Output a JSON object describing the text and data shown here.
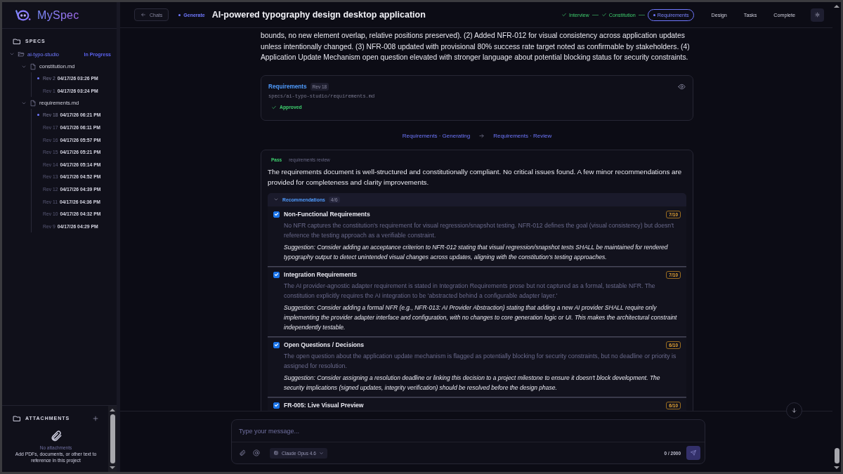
{
  "app_name": "MySpec",
  "sidebar": {
    "specs_heading": "SPECS",
    "specs": [
      {
        "name": "ai-typo-studio",
        "status": "In Progress",
        "expanded": true,
        "children": [
          {
            "name": "constitution.md",
            "expanded": true,
            "children": [
              {
                "rev": "Rev 2",
                "date": "04/17/26 03:26 PM",
                "selected": true
              },
              {
                "rev": "Rev 1",
                "date": "04/17/26 03:24 PM",
                "selected": false
              }
            ]
          },
          {
            "name": "requirements.md",
            "expanded": true,
            "children": [
              {
                "rev": "Rev 18",
                "date": "04/17/26 06:21 PM",
                "selected": true
              },
              {
                "rev": "Rev 17",
                "date": "04/17/26 06:11 PM",
                "selected": false
              },
              {
                "rev": "Rev 16",
                "date": "04/17/26 05:57 PM",
                "selected": false
              },
              {
                "rev": "Rev 15",
                "date": "04/17/26 05:21 PM",
                "selected": false
              },
              {
                "rev": "Rev 14",
                "date": "04/17/26 05:14 PM",
                "selected": false
              },
              {
                "rev": "Rev 13",
                "date": "04/17/26 04:52 PM",
                "selected": false
              },
              {
                "rev": "Rev 12",
                "date": "04/17/26 04:39 PM",
                "selected": false
              },
              {
                "rev": "Rev 11",
                "date": "04/17/26 04:36 PM",
                "selected": false
              },
              {
                "rev": "Rev 10",
                "date": "04/17/26 04:32 PM",
                "selected": false
              },
              {
                "rev": "Rev 9",
                "date": "04/17/26 04:29 PM",
                "selected": false
              }
            ]
          }
        ]
      }
    ],
    "attachments": {
      "heading": "ATTACHMENTS",
      "empty_title": "No attachments",
      "empty_hint": "Add PDFs, documents, or other text to reference in this project"
    }
  },
  "header": {
    "back_label": "Chats",
    "mode": "Generate",
    "title": "AI-powered typography design desktop application",
    "steps": [
      {
        "label": "Interview",
        "done": true,
        "selected": false
      },
      {
        "label": "Constitution",
        "done": true,
        "selected": false
      },
      {
        "label": "Requirements",
        "done": false,
        "selected": true
      },
      {
        "label": "Design",
        "done": false,
        "selected": false
      },
      {
        "label": "Tasks",
        "done": false,
        "selected": false
      },
      {
        "label": "Complete",
        "done": false,
        "selected": false
      }
    ]
  },
  "messages": {
    "summary": "bounds, no new element overlap, relative positions preserved). (2) Added NFR-012 for visual consistency across application updates unless intentionally changed. (3) NFR-008 updated with provisional 80% success rate target noted as confirmable by stakeholders. (4) Application Update Mechanism open question elevated with stronger language about potential blocking status for security constraints.",
    "document": {
      "title": "Requirements",
      "rev": "Rev 18",
      "path": "specs/ai-typo-studio/requirements.md",
      "status": "Approved"
    },
    "transition": {
      "from": "Requirements · Generating",
      "to": "Requirements · Review"
    },
    "review": {
      "verdict": "Pass",
      "label": "requirements review",
      "text": "The requirements document is well-structured and constitutionally compliant. No critical issues found. A few minor recommendations are provided for completeness and clarity improvements.",
      "recommendations_title": "Recommendations",
      "recommendations_count": "4/6",
      "expanded": true,
      "items": [
        {
          "title": "Non-Functional Requirements",
          "score": "7/10",
          "checked": true,
          "detail": "No NFR captures the constitution's requirement for visual regression/snapshot testing. NFR-012 defines the goal (visual consistency) but doesn't reference the testing approach as a verifiable constraint.",
          "suggestion": "Suggestion: Consider adding an acceptance criterion to NFR-012 stating that visual regression/snapshot tests SHALL be maintained for rendered typography output to detect unintended visual changes across updates, aligning with the constitution's testing approaches."
        },
        {
          "title": "Integration Requirements",
          "score": "7/10",
          "checked": true,
          "detail": "The AI provider-agnostic adapter requirement is stated in Integration Requirements prose but not captured as a formal, testable NFR. The constitution explicitly requires the AI integration to be 'abstracted behind a configurable adapter layer.'",
          "suggestion": "Suggestion: Consider adding a formal NFR (e.g., NFR-013: AI Provider Abstraction) stating that adding a new AI provider SHALL require only implementing the provider adapter interface and configuration, with no changes to core generation logic or UI. This makes the architectural constraint independently testable."
        },
        {
          "title": "Open Questions / Decisions",
          "score": "6/10",
          "checked": true,
          "detail": "The open question about the application update mechanism is flagged as potentially blocking for security constraints, but no deadline or priority is assigned for resolution.",
          "suggestion": "Suggestion: Consider assigning a resolution deadline or linking this decision to a project milestone to ensure it doesn't block development. The security implications (signed updates, integrity verification) should be resolved before the design phase."
        },
        {
          "title": "FR-005: Live Visual Preview",
          "score": "6/10",
          "checked": true
        }
      ]
    }
  },
  "composer": {
    "placeholder": "Type your message...",
    "model": "Claude Opus 4.6",
    "counter": "0 / 2000"
  }
}
